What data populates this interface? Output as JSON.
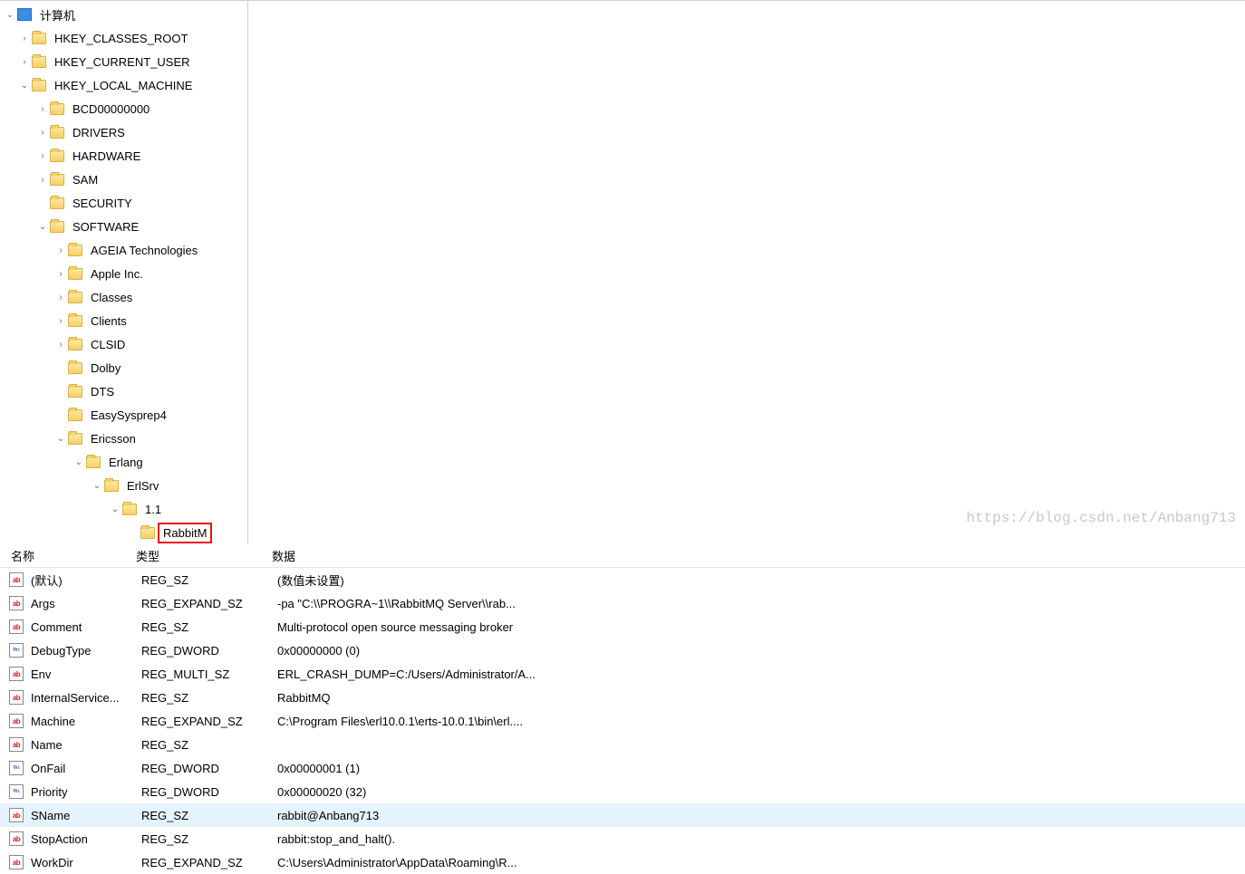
{
  "tree": {
    "root_label": "计算机",
    "hkcr": "HKEY_CLASSES_ROOT",
    "hkcu": "HKEY_CURRENT_USER",
    "hklm": "HKEY_LOCAL_MACHINE",
    "bcd": "BCD00000000",
    "drivers": "DRIVERS",
    "hardware": "HARDWARE",
    "sam": "SAM",
    "security": "SECURITY",
    "software": "SOFTWARE",
    "ageia": "AGEIA Technologies",
    "apple": "Apple Inc.",
    "classes": "Classes",
    "clients": "Clients",
    "clsid": "CLSID",
    "dolby": "Dolby",
    "dts": "DTS",
    "easysys": "EasySysprep4",
    "ericsson": "Ericsson",
    "erlang": "Erlang",
    "erlsrv": "ErlSrv",
    "v11": "1.1",
    "rabbitm": "RabbitM"
  },
  "chevron_right": "›",
  "chevron_down": "⌄",
  "list": {
    "header_name": "名称",
    "header_type": "类型",
    "header_data": "数据",
    "rows": [
      {
        "icon": "str",
        "name": "(默认)",
        "type": "REG_SZ",
        "data": "(数值未设置)"
      },
      {
        "icon": "str",
        "name": "Args",
        "type": "REG_EXPAND_SZ",
        "data": " -pa \"C:\\\\PROGRA~1\\\\RabbitMQ Server\\\\rab..."
      },
      {
        "icon": "str",
        "name": "Comment",
        "type": "REG_SZ",
        "data": "Multi-protocol open source messaging broker"
      },
      {
        "icon": "bin",
        "name": "DebugType",
        "type": "REG_DWORD",
        "data": "0x00000000 (0)"
      },
      {
        "icon": "str",
        "name": "Env",
        "type": "REG_MULTI_SZ",
        "data": "ERL_CRASH_DUMP=C:/Users/Administrator/A..."
      },
      {
        "icon": "str",
        "name": "InternalService...",
        "type": "REG_SZ",
        "data": "RabbitMQ"
      },
      {
        "icon": "str",
        "name": "Machine",
        "type": "REG_EXPAND_SZ",
        "data": "C:\\Program Files\\erl10.0.1\\erts-10.0.1\\bin\\erl...."
      },
      {
        "icon": "str",
        "name": "Name",
        "type": "REG_SZ",
        "data": ""
      },
      {
        "icon": "bin",
        "name": "OnFail",
        "type": "REG_DWORD",
        "data": "0x00000001 (1)"
      },
      {
        "icon": "bin",
        "name": "Priority",
        "type": "REG_DWORD",
        "data": "0x00000020 (32)"
      },
      {
        "icon": "str",
        "name": "SName",
        "type": "REG_SZ",
        "data": "rabbit@Anbang713",
        "selected": true
      },
      {
        "icon": "str",
        "name": "StopAction",
        "type": "REG_SZ",
        "data": "rabbit:stop_and_halt()."
      },
      {
        "icon": "str",
        "name": "WorkDir",
        "type": "REG_EXPAND_SZ",
        "data": "C:\\Users\\Administrator\\AppData\\Roaming\\R..."
      }
    ]
  },
  "icon_glyphs": {
    "str": "ab",
    "bin": "011\n110"
  },
  "watermark": "https://blog.csdn.net/Anbang713"
}
